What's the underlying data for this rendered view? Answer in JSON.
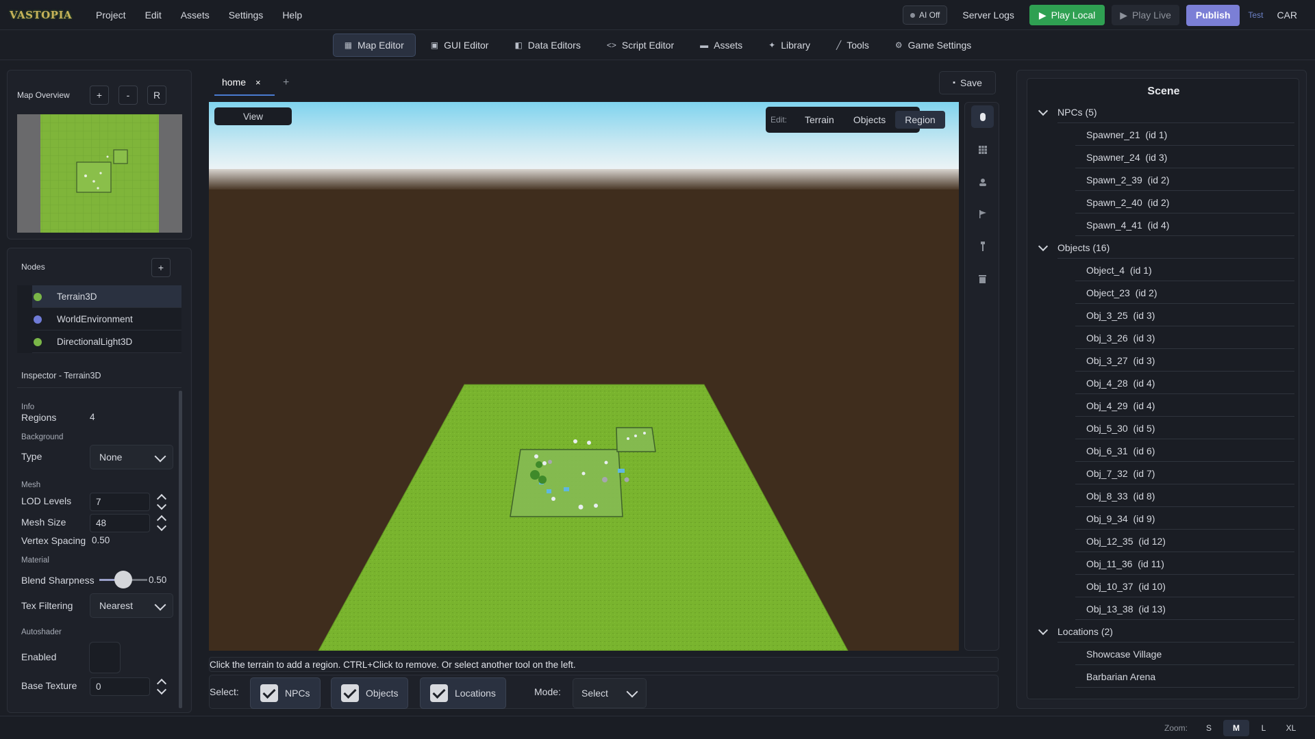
{
  "app": {
    "logo_text": "VASTOPIA"
  },
  "menu": [
    "Project",
    "Edit",
    "Assets",
    "Settings",
    "Help"
  ],
  "topbar": {
    "ai_toggle": "AI Off",
    "server_logs": "Server Logs",
    "play_local": "Play Local",
    "play_live": "Play Live",
    "publish": "Publish",
    "test": "Test",
    "user": "CAR",
    "colors": {
      "play_local": "#2fa052",
      "publish": "#7b7fd6"
    }
  },
  "editor_tabs": [
    {
      "label": "Map Editor",
      "icon": "map-icon",
      "active": true
    },
    {
      "label": "GUI Editor",
      "icon": "image-icon",
      "active": false
    },
    {
      "label": "Data Editors",
      "icon": "database-icon",
      "active": false
    },
    {
      "label": "Script Editor",
      "icon": "code-icon",
      "active": false
    },
    {
      "label": "Assets",
      "icon": "folder-icon",
      "active": false
    },
    {
      "label": "Library",
      "icon": "sparkle-icon",
      "active": false
    },
    {
      "label": "Tools",
      "icon": "wrench-icon",
      "active": false
    },
    {
      "label": "Game Settings",
      "icon": "gear-icon",
      "active": false
    }
  ],
  "map_overview": {
    "title": "Map Overview",
    "buttons": [
      "+",
      "-",
      "R"
    ]
  },
  "nodes": {
    "title": "Nodes",
    "add": "+",
    "items": [
      {
        "label": "Terrain3D",
        "color": "#7ab648",
        "selected": true
      },
      {
        "label": "WorldEnvironment",
        "color": "#6f7bd6",
        "selected": false
      },
      {
        "label": "DirectionalLight3D",
        "color": "#7ab648",
        "selected": false
      }
    ]
  },
  "inspector": {
    "title": "Inspector - Terrain3D",
    "info_section": "Info",
    "regions_label": "Regions",
    "regions_value": "4",
    "background_section": "Background",
    "type_label": "Type",
    "type_value": "None",
    "mesh_section": "Mesh",
    "lod_label": "LOD Levels",
    "lod_value": "7",
    "mesh_size_label": "Mesh Size",
    "mesh_size_value": "48",
    "vertex_spacing_label": "Vertex Spacing",
    "vertex_spacing_value": "0.50",
    "material_section": "Material",
    "blend_label": "Blend Sharpness",
    "blend_value": "0.50",
    "blend_fraction": 0.5,
    "tex_filter_label": "Tex Filtering",
    "tex_filter_value": "Nearest",
    "autoshader_section": "Autoshader",
    "enabled_label": "Enabled",
    "base_texture_label": "Base Texture",
    "base_texture_value": "0"
  },
  "document": {
    "tab_label": "home",
    "close": "×",
    "add": "+",
    "save": "Save"
  },
  "viewport": {
    "view_button": "View",
    "edit_label": "Edit:",
    "edit_options": [
      "Terrain",
      "Objects",
      "Region"
    ],
    "active_edit": "Region"
  },
  "side_tools": [
    "mouse-icon",
    "grid-icon",
    "person-icon",
    "flag-icon",
    "pin-icon",
    "trash-icon"
  ],
  "hint": "Click the terrain to add a region. CTRL+Click to remove. Or select another tool on the left.",
  "bottom": {
    "select_label": "Select:",
    "filters": [
      "NPCs",
      "Objects",
      "Locations"
    ],
    "mode_label": "Mode:",
    "mode_value": "Select"
  },
  "scene": {
    "title": "Scene",
    "groups": [
      {
        "label": "NPCs (5)",
        "items": [
          "Spawner_21  (id 1)",
          "Spawner_24  (id 3)",
          "Spawn_2_39  (id 2)",
          "Spawn_2_40  (id 2)",
          "Spawn_4_41  (id 4)"
        ]
      },
      {
        "label": "Objects (16)",
        "items": [
          "Object_4  (id 1)",
          "Object_23  (id 2)",
          "Obj_3_25  (id 3)",
          "Obj_3_26  (id 3)",
          "Obj_3_27  (id 3)",
          "Obj_4_28  (id 4)",
          "Obj_4_29  (id 4)",
          "Obj_5_30  (id 5)",
          "Obj_6_31  (id 6)",
          "Obj_7_32  (id 7)",
          "Obj_8_33  (id 8)",
          "Obj_9_34  (id 9)",
          "Obj_12_35  (id 12)",
          "Obj_11_36  (id 11)",
          "Obj_10_37  (id 10)",
          "Obj_13_38  (id 13)"
        ]
      },
      {
        "label": "Locations (2)",
        "items": [
          "Showcase Village",
          "Barbarian Arena"
        ]
      }
    ]
  },
  "zoom": {
    "label": "Zoom:",
    "options": [
      "S",
      "M",
      "L",
      "XL"
    ],
    "active": "M"
  }
}
